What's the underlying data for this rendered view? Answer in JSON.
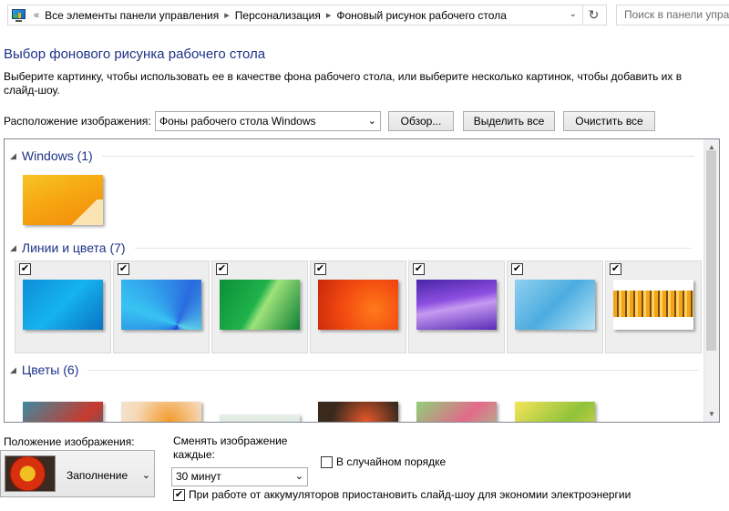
{
  "address": {
    "crumbs": [
      "Все элементы панели управления",
      "Персонализация",
      "Фоновый рисунок рабочего стола"
    ],
    "back_glyph": "«",
    "sep_glyph": "▸",
    "dropdown_glyph": "⌄",
    "refresh_glyph": "↻",
    "search_placeholder": "Поиск в панели упра"
  },
  "page": {
    "title": "Выбор фонового рисунка рабочего стола",
    "description": "Выберите картинку, чтобы использовать ее в качестве фона рабочего стола, или выберите несколько картинок, чтобы добавить их в слайд-шоу."
  },
  "location": {
    "label": "Расположение изображения:",
    "value": "Фоны рабочего стола Windows",
    "browse": "Обзор...",
    "select_all": "Выделить все",
    "clear_all": "Очистить все"
  },
  "groups": [
    {
      "title": "Windows (1)",
      "thumbs": [
        "w8"
      ],
      "checked": false
    },
    {
      "title": "Линии и цвета (7)",
      "thumbs": [
        "t1",
        "t2",
        "t3",
        "t4",
        "t5",
        "t6",
        "t7"
      ],
      "checked": true
    },
    {
      "title": "Цветы (6)",
      "thumbs": [
        "f1",
        "f2",
        "f3",
        "f4",
        "f5",
        "f6"
      ],
      "checked": false
    }
  ],
  "check_glyph": "✔",
  "arrow_glyph": "⌄",
  "position": {
    "label": "Положение изображения:",
    "value": "Заполнение"
  },
  "interval": {
    "label": "Сменять изображение каждые:",
    "value": "30 минут"
  },
  "shuffle": {
    "label": "В случайном порядке",
    "checked": false
  },
  "battery": {
    "label": "При работе от аккумуляторов приостановить слайд-шоу для экономии электроэнергии",
    "checked": true
  },
  "colors": {
    "title_blue": "#1e3287"
  }
}
